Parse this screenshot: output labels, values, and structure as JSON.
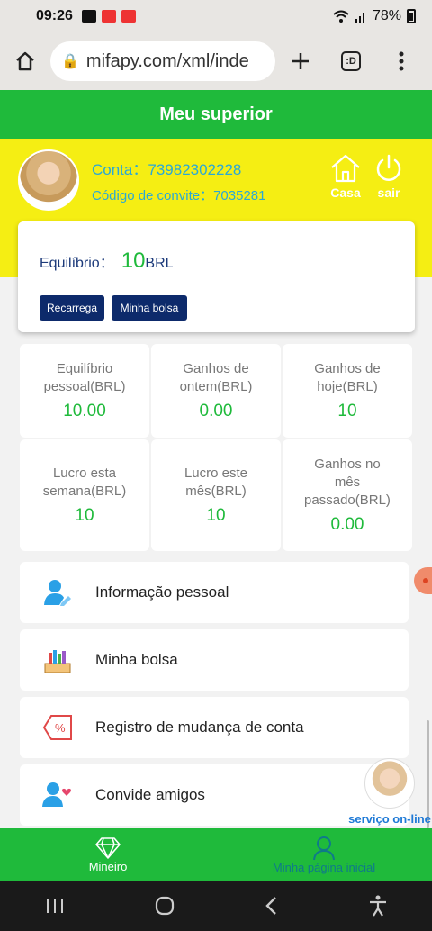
{
  "status_bar": {
    "time": "09:26",
    "battery": "78%"
  },
  "browser": {
    "url": "mifapy.com/xml/inde",
    "tabs_count": ":D"
  },
  "header": {
    "title": "Meu superior"
  },
  "profile": {
    "account_label": "Conta：",
    "account_value": "73982302228",
    "invite_label": "Código de convite：",
    "invite_value": "7035281",
    "home_label": "Casa",
    "exit_label": "sair"
  },
  "balance": {
    "label": "Equilíbrio：",
    "value": "10",
    "unit": "BRL",
    "recharge_label": "Recarrega",
    "wallet_label": "Minha bolsa"
  },
  "stats": [
    {
      "label_1": "Equilíbrio",
      "label_2": "pessoal(BRL)",
      "label_3": "",
      "value": "10.00"
    },
    {
      "label_1": "Ganhos de",
      "label_2": "ontem(BRL)",
      "label_3": "",
      "value": "0.00"
    },
    {
      "label_1": "Ganhos de",
      "label_2": "hoje(BRL)",
      "label_3": "",
      "value": "10"
    },
    {
      "label_1": "Lucro esta",
      "label_2": "semana(BRL)",
      "label_3": "",
      "value": "10"
    },
    {
      "label_1": "Lucro este",
      "label_2": "mês(BRL)",
      "label_3": "",
      "value": "10"
    },
    {
      "label_1": "Ganhos no",
      "label_2": "mês",
      "label_3": "passado(BRL)",
      "value": "0.00"
    }
  ],
  "menu": [
    {
      "label": "Informação pessoal",
      "icon": "person-edit-icon"
    },
    {
      "label": "Minha bolsa",
      "icon": "wallet-icon"
    },
    {
      "label": "Registro de mudança de conta",
      "icon": "percent-tag-icon"
    },
    {
      "label": "Convide amigos",
      "icon": "invite-friend-icon"
    }
  ],
  "customer_service": {
    "label": "serviço on-line"
  },
  "bottom_nav": [
    {
      "label": "Mineiro",
      "icon": "diamond-icon",
      "active": false
    },
    {
      "label": "Minha página inicial",
      "icon": "profile-icon",
      "active": true
    }
  ],
  "colors": {
    "brand_green": "#1fba3b",
    "banner_yellow": "#f5ee13",
    "button_navy": "#0d2a6b",
    "text_blue": "#2aa8d6"
  }
}
